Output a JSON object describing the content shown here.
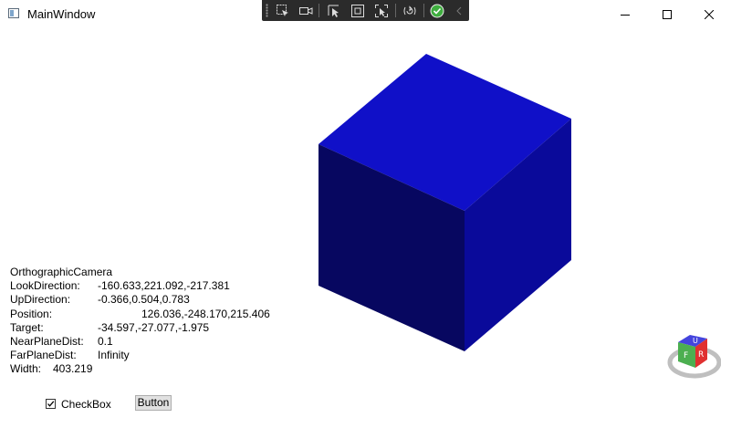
{
  "window": {
    "title": "MainWindow"
  },
  "titlebar_buttons": {
    "minimize": "minimize-icon",
    "maximize": "maximize-icon",
    "close": "close-icon"
  },
  "debug_toolbar": {
    "items": [
      "grip-handle",
      "select-element-icon",
      "video-icon",
      "pointer-select-icon",
      "layout-adorner-icon",
      "track-focus-icon",
      "hot-reload-icon",
      "check-circle-icon",
      "chevron-left-icon"
    ]
  },
  "scene": {
    "cube": {
      "top_color": "#1010c8",
      "left_color": "#070760",
      "right_color": "#0a0a9a"
    },
    "viewcube": {
      "faces": [
        "U",
        "R",
        "F"
      ]
    }
  },
  "camera_info": {
    "heading": "OrthographicCamera",
    "rows": [
      {
        "label": "LookDirection:",
        "value": "-160.633,221.092,-217.381"
      },
      {
        "label": "UpDirection:",
        "value": "-0.366,0.504,0.783"
      },
      {
        "label": "Position:",
        "value": "126.036,-248.170,215.406"
      },
      {
        "label": "Target:",
        "value": "-34.597,-27.077,-1.975"
      },
      {
        "label": "NearPlaneDist:",
        "value": "0.1"
      },
      {
        "label": "FarPlaneDist:",
        "value": "Infinity"
      },
      {
        "label": "Width:",
        "value": "403.219"
      }
    ]
  },
  "controls": {
    "checkbox": {
      "label": "CheckBox",
      "checked": true
    },
    "button": {
      "label": "Button"
    }
  }
}
